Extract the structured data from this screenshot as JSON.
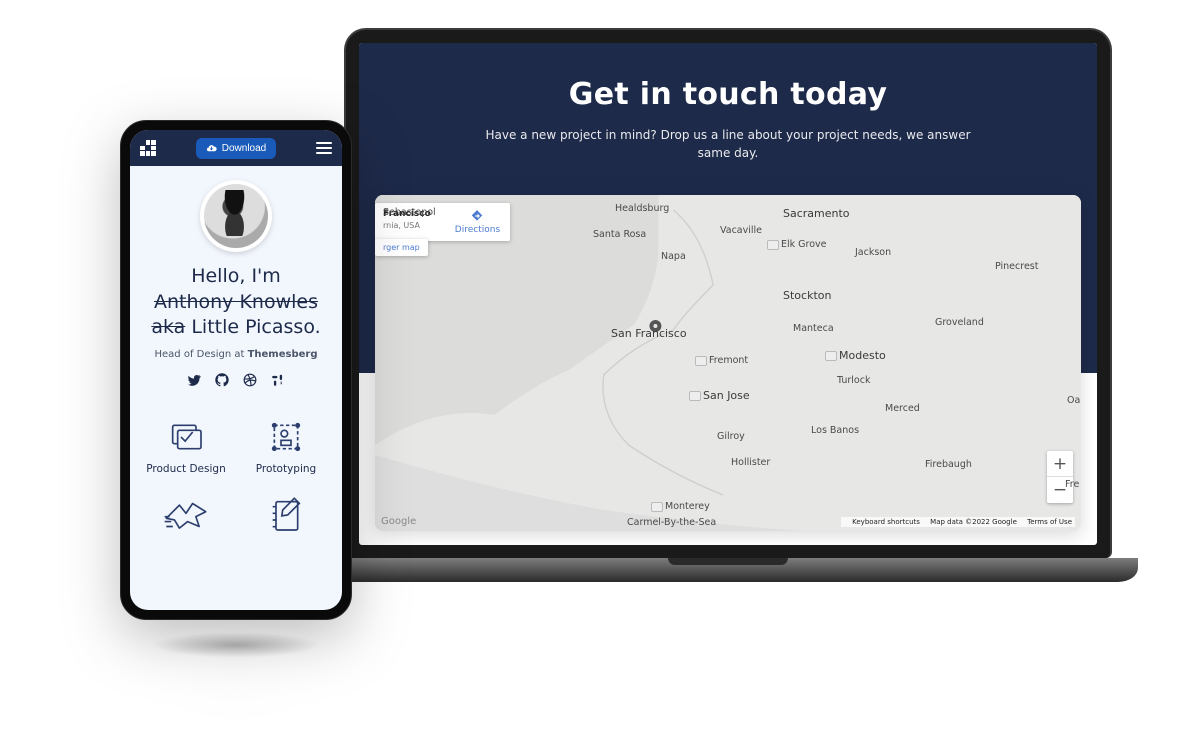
{
  "laptop": {
    "hero_title": "Get in touch today",
    "hero_sub1": "Have a new project in mind? Drop us a line about your project needs, we answer",
    "hero_sub2": "same day.",
    "map": {
      "card_title": "Francisco",
      "card_sub": "rnia, USA",
      "directions": "Directions",
      "larger_map": "rger map",
      "google": "Google",
      "keyboard": "Keyboard shortcuts",
      "mapdata": "Map data ©2022 Google",
      "terms": "Terms of Use",
      "zoom_in": "+",
      "zoom_out": "−",
      "cities": {
        "sebastopol": "Sebastopol",
        "healdsburg": "Healdsburg",
        "santa_rosa": "Santa Rosa",
        "napa": "Napa",
        "vacaville": "Vacaville",
        "sacramento": "Sacramento",
        "elk_grove": "Elk Grove",
        "jackson": "Jackson",
        "pinecrest": "Pinecrest",
        "stockton": "Stockton",
        "manteca": "Manteca",
        "groveland": "Groveland",
        "san_francisco": "San Francisco",
        "fremont": "Fremont",
        "modesto": "Modesto",
        "turlock": "Turlock",
        "san_jose": "San Jose",
        "merced": "Merced",
        "oak": "Oak",
        "los_banos": "Los Banos",
        "gilroy": "Gilroy",
        "hollister": "Hollister",
        "firebaugh": "Firebaugh",
        "fre": "Fre",
        "monterey": "Monterey",
        "carmel": "Carmel-By-the-Sea"
      }
    }
  },
  "phone": {
    "download": "Download",
    "hello": "Hello, I'm",
    "name_strike": "Anthony Knowles",
    "aka": "aka",
    "nickname": " Little Picasso.",
    "role_prefix": "Head of Design at ",
    "role_company": "Themesberg",
    "skills": {
      "product_design": "Product Design",
      "prototyping": "Prototyping"
    }
  }
}
